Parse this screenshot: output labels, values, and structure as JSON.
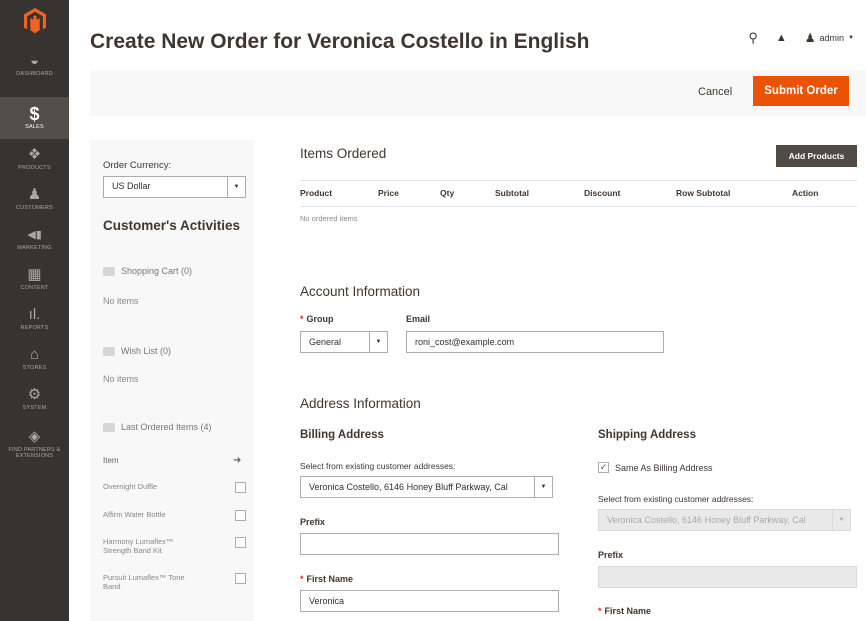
{
  "sidebar": {
    "logo": "magento-logo",
    "items": [
      {
        "label": "DASHBOARD",
        "icon": "dashboard-icon",
        "glyph": "◒"
      },
      {
        "label": "SALES",
        "icon": "dollar-icon",
        "glyph": "$"
      },
      {
        "label": "PRODUCTS",
        "icon": "cube-icon",
        "glyph": "❖"
      },
      {
        "label": "CUSTOMERS",
        "icon": "person-icon",
        "glyph": "♟"
      },
      {
        "label": "MARKETING",
        "icon": "megaphone-icon",
        "glyph": "📢"
      },
      {
        "label": "CONTENT",
        "icon": "layout-icon",
        "glyph": "▦"
      },
      {
        "label": "REPORTS",
        "icon": "bar-chart-icon",
        "glyph": "ıl."
      },
      {
        "label": "STORES",
        "icon": "storefront-icon",
        "glyph": "⌂"
      },
      {
        "label": "SYSTEM",
        "icon": "gear-icon",
        "glyph": "⚙"
      },
      {
        "label": "FIND PARTNERS & EXTENSIONS",
        "icon": "puzzle-icon",
        "glyph": "◈"
      }
    ]
  },
  "header": {
    "title": "Create New Order for Veronica Costello in English",
    "user": "admin"
  },
  "actions": {
    "cancel": "Cancel",
    "submit": "Submit Order"
  },
  "left": {
    "currency_label": "Order Currency:",
    "currency_value": "US Dollar",
    "activities_title": "Customer's Activities",
    "shopping_cart": "Shopping Cart (0)",
    "no_items_1": "No items",
    "wish_list": "Wish List (0)",
    "no_items_2": "No items",
    "last_ordered": "Last Ordered Items (4)",
    "item_header": "Item",
    "items": [
      "Overnight Duffle",
      "Affirm Water Bottle",
      "Harmony Lumaflex™ Strength Band Kit",
      "Pursuit Lumaflex™ Tone Band"
    ]
  },
  "items_ordered": {
    "title": "Items Ordered",
    "add_button": "Add Products",
    "columns": [
      "Product",
      "Price",
      "Qty",
      "Subtotal",
      "Discount",
      "Row Subtotal",
      "Action"
    ],
    "empty": "No ordered items"
  },
  "account": {
    "title": "Account Information",
    "group_label": "Group",
    "group_value": "General",
    "email_label": "Email",
    "email_value": "roni_cost@example.com"
  },
  "address": {
    "title": "Address Information",
    "billing": {
      "title": "Billing Address",
      "select_label": "Select from existing customer addresses:",
      "select_value": "Veronica Costello, 6146 Honey Bluff Parkway, Cal",
      "prefix_label": "Prefix",
      "prefix_value": "",
      "first_name_label": "First Name",
      "first_name_value": "Veronica"
    },
    "shipping": {
      "title": "Shipping Address",
      "same_as_billing": "Same As Billing Address",
      "same_checked": "✓",
      "select_label": "Select from existing customer addresses:",
      "select_value": "Veronica Costello, 6146 Honey Bluff Parkway, Cal",
      "prefix_label": "Prefix",
      "first_name_label": "First Name"
    }
  },
  "colors": {
    "sidebar_bg": "#373330",
    "accent": "#eb5202",
    "dark_button": "#514943"
  }
}
